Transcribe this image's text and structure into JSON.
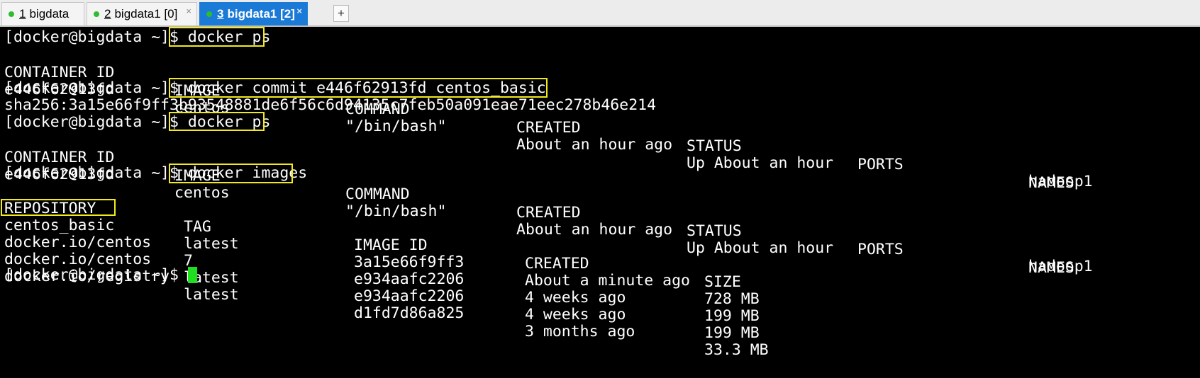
{
  "tabs": [
    {
      "number": "1",
      "label": "bigdata",
      "status": "connected",
      "active": false
    },
    {
      "number": "2",
      "label": "bigdata1 [0]",
      "status": "connected",
      "active": false
    },
    {
      "number": "3",
      "label": "bigdata1 [2]",
      "status": "connected",
      "active": true
    }
  ],
  "new_tab_label": "+",
  "close_glyph": "×",
  "colors": {
    "highlight": "#f2ea1e",
    "active_tab": "#1a7ad6",
    "cursor": "#1fe01f",
    "status_dot": "#2ebd2e"
  },
  "terminal": {
    "prompt": "[docker@bigdata ~]$ ",
    "commands": [
      "docker ps",
      "docker commit e446f62913fd centos_basic",
      "docker ps",
      "docker images"
    ],
    "ps_header": [
      "CONTAINER ID",
      "IMAGE",
      "COMMAND",
      "CREATED",
      "STATUS",
      "PORTS",
      "NAMES"
    ],
    "ps_row": [
      "e446f62913fd",
      "centos",
      "\"/bin/bash\"",
      "About an hour ago",
      "Up About an hour",
      "",
      "hadoop1"
    ],
    "commit_output": "sha256:3a15e66f9ff3b93548881de6f56c6d94135c7feb50a091eae71eec278b46e214",
    "images_header": [
      "REPOSITORY",
      "TAG",
      "IMAGE ID",
      "CREATED",
      "SIZE"
    ],
    "images_rows": [
      [
        "centos_basic",
        "latest",
        "3a15e66f9ff3",
        "About a minute ago",
        "728 MB"
      ],
      [
        "docker.io/centos",
        "7",
        "e934aafc2206",
        "4 weeks ago",
        "199 MB"
      ],
      [
        "docker.io/centos",
        "latest",
        "e934aafc2206",
        "4 weeks ago",
        "199 MB"
      ],
      [
        "docker.io/registry",
        "latest",
        "d1fd7d86a825",
        "3 months ago",
        "33.3 MB"
      ]
    ]
  }
}
